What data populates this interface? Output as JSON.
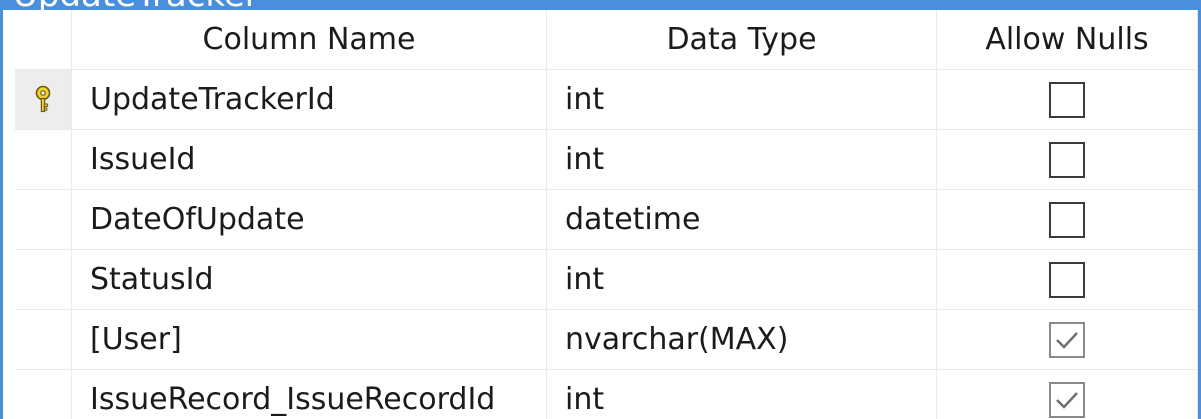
{
  "window": {
    "title_fragment": "UpdateTracker",
    "accent_color": "#4a8fdc"
  },
  "grid": {
    "headers": {
      "column_name": "Column Name",
      "data_type": "Data Type",
      "allow_nulls": "Allow Nulls"
    },
    "rows": [
      {
        "name": "UpdateTrackerId",
        "type": "int",
        "allow_nulls": false,
        "primary_key": true
      },
      {
        "name": "IssueId",
        "type": "int",
        "allow_nulls": false,
        "primary_key": false
      },
      {
        "name": "DateOfUpdate",
        "type": "datetime",
        "allow_nulls": false,
        "primary_key": false
      },
      {
        "name": "StatusId",
        "type": "int",
        "allow_nulls": false,
        "primary_key": false
      },
      {
        "name": "[User]",
        "type": "nvarchar(MAX)",
        "allow_nulls": true,
        "primary_key": false
      },
      {
        "name": "IssueRecord_IssueRecordId",
        "type": "int",
        "allow_nulls": true,
        "primary_key": false
      }
    ],
    "icons": {
      "primary_key": "key-icon",
      "checked": "checkmark-icon"
    }
  }
}
